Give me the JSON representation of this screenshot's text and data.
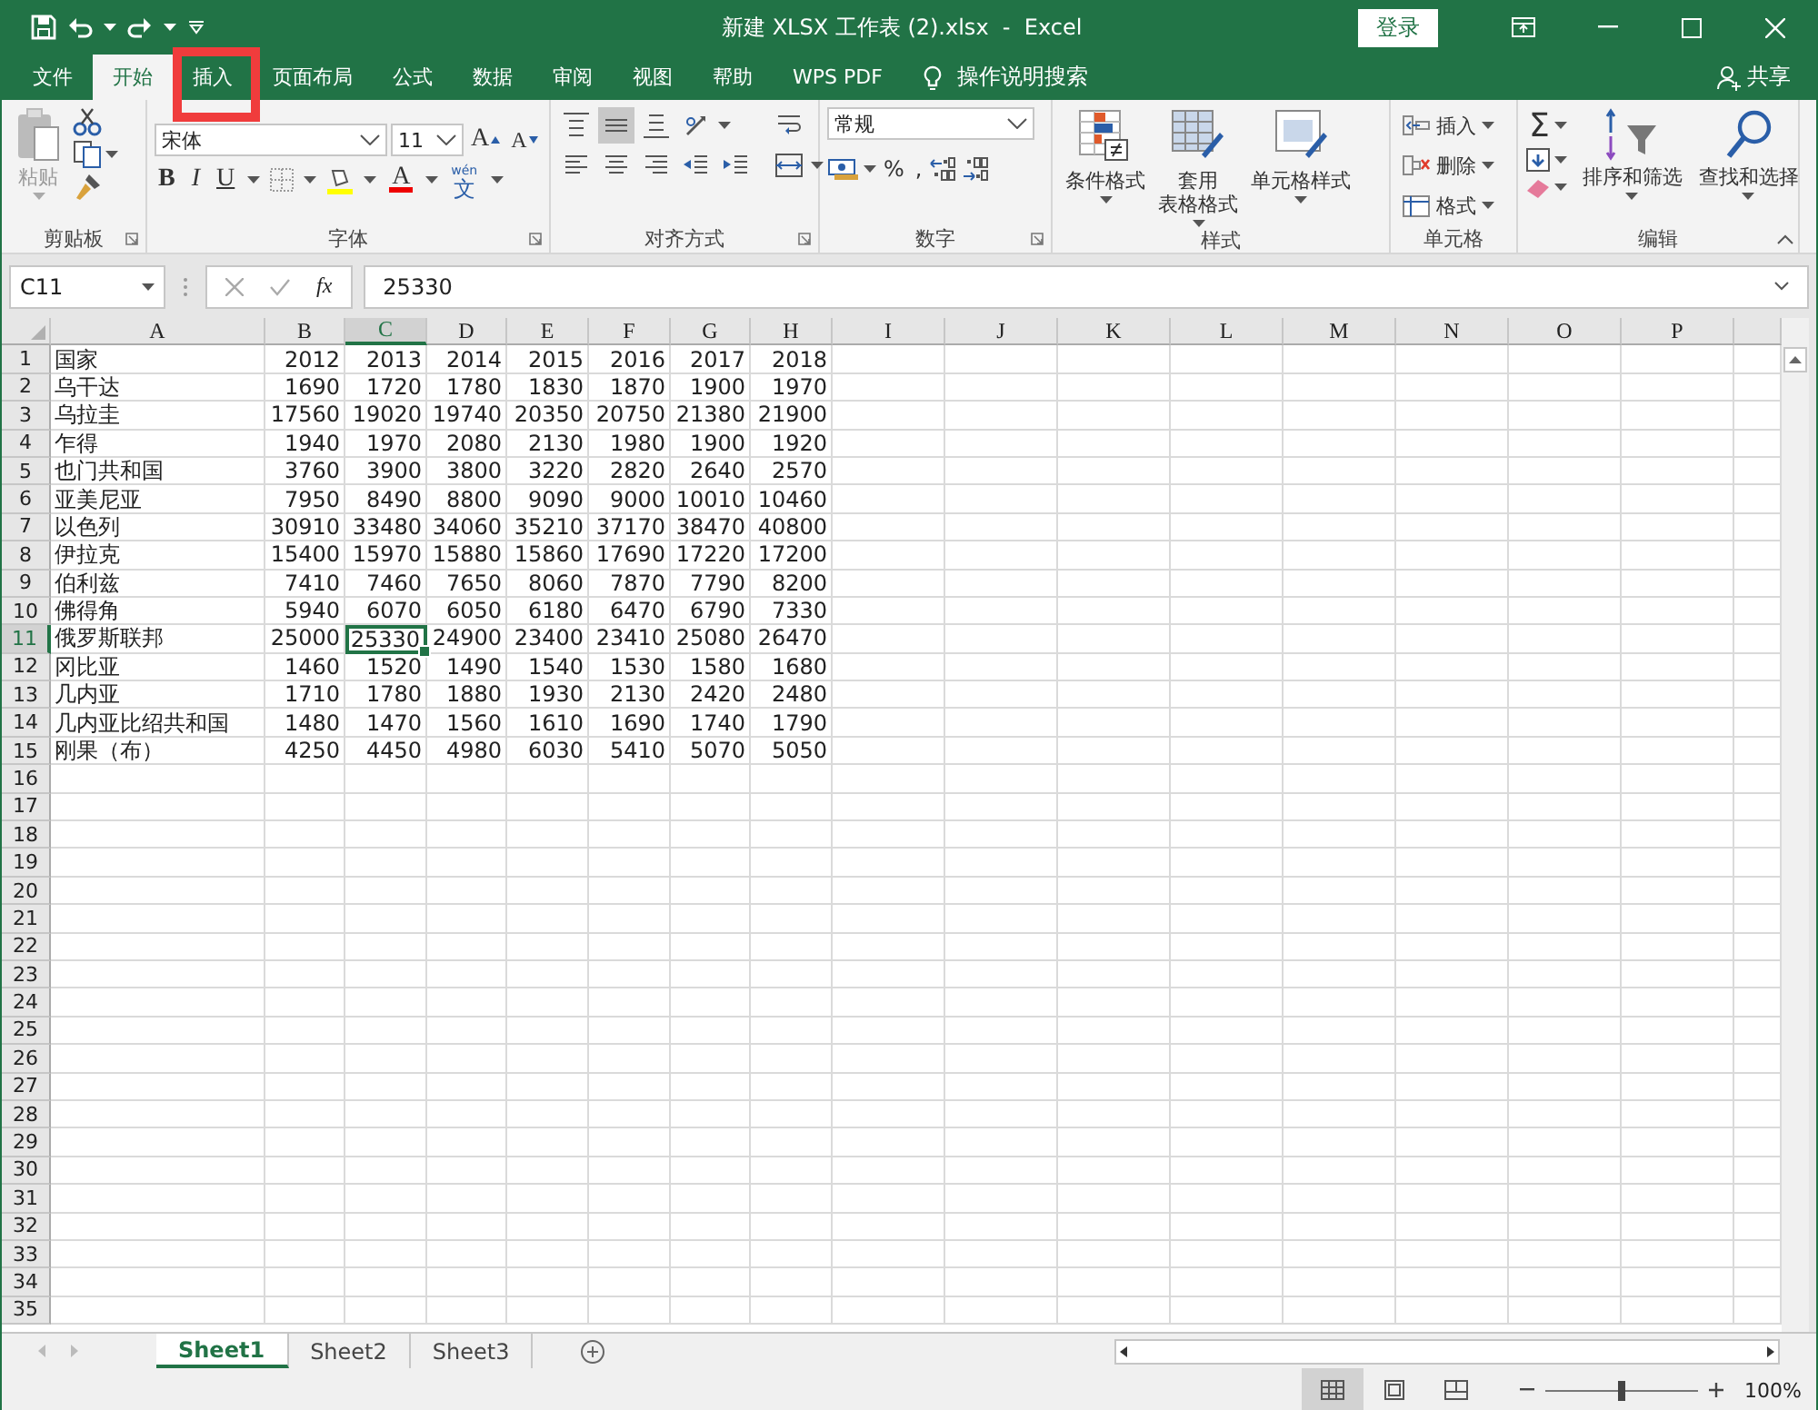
{
  "window": {
    "title": "新建 XLSX 工作表 (2).xlsx  -  Excel",
    "sign_in": "登录"
  },
  "tabs": [
    {
      "label": "文件",
      "selected": false
    },
    {
      "label": "开始",
      "selected": true
    },
    {
      "label": "插入",
      "selected": false
    },
    {
      "label": "页面布局",
      "selected": false
    },
    {
      "label": "公式",
      "selected": false
    },
    {
      "label": "数据",
      "selected": false
    },
    {
      "label": "审阅",
      "selected": false
    },
    {
      "label": "视图",
      "selected": false
    },
    {
      "label": "帮助",
      "selected": false
    },
    {
      "label": "WPS PDF",
      "selected": false
    }
  ],
  "tell_me": "操作说明搜索",
  "share": "共享",
  "ribbon": {
    "clipboard": {
      "label": "剪贴板",
      "paste": {
        "label": "粘贴",
        "disabled": true
      }
    },
    "font": {
      "label": "字体",
      "font_name": "宋体",
      "font_size": "11",
      "grow": "A",
      "shrink": "A",
      "bold": "B",
      "italic": "I",
      "underline": "U",
      "font_color": "A",
      "phonetic": {
        "ruby": "wén",
        "label": "文"
      }
    },
    "alignment": {
      "label": "对齐方式",
      "top_row": [
        {
          "kind": "align-top",
          "selected": false
        },
        {
          "kind": "align-middle",
          "selected": true
        },
        {
          "kind": "align-bottom",
          "selected": false
        },
        {
          "kind": "orientation",
          "selected": false
        }
      ],
      "bottom_row": [
        {
          "kind": "align-left",
          "selected": false
        },
        {
          "kind": "align-center",
          "selected": false
        },
        {
          "kind": "align-right",
          "selected": false
        },
        {
          "kind": "outdent",
          "selected": false
        },
        {
          "kind": "indent",
          "selected": false
        }
      ],
      "side": [
        {
          "kind": "wrap",
          "selected": false
        },
        {
          "kind": "merge",
          "selected": false
        }
      ]
    },
    "number": {
      "label": "数字",
      "format": "常规",
      "percent": "%",
      "comma": ","
    },
    "styles": {
      "label": "样式",
      "buttons": [
        {
          "kind": "conditional",
          "lines": [
            "条件格式"
          ]
        },
        {
          "kind": "table",
          "lines": [
            "套用",
            "表格格式"
          ]
        },
        {
          "kind": "cell-style",
          "lines": [
            "单元格样式"
          ]
        }
      ]
    },
    "cells": {
      "label": "单元格",
      "buttons": [
        {
          "kind": "insert",
          "label": "插入"
        },
        {
          "kind": "delete",
          "label": "删除"
        },
        {
          "kind": "format",
          "label": "格式"
        }
      ]
    },
    "editing": {
      "label": "编辑",
      "autosum": "Σ",
      "sort": "排序和筛选",
      "find": "查找和选择"
    }
  },
  "formula_bar": {
    "name_box": "C11",
    "function": "fx",
    "value": "25330"
  },
  "columns": [
    {
      "label": "A",
      "selected": false
    },
    {
      "label": "B",
      "selected": false
    },
    {
      "label": "C",
      "selected": true
    },
    {
      "label": "D",
      "selected": false
    },
    {
      "label": "E",
      "selected": false
    },
    {
      "label": "F",
      "selected": false
    },
    {
      "label": "G",
      "selected": false
    },
    {
      "label": "H",
      "selected": false
    },
    {
      "label": "I",
      "selected": false
    },
    {
      "label": "J",
      "selected": false
    },
    {
      "label": "K",
      "selected": false
    },
    {
      "label": "L",
      "selected": false
    },
    {
      "label": "M",
      "selected": false
    },
    {
      "label": "N",
      "selected": false
    },
    {
      "label": "O",
      "selected": false
    },
    {
      "label": "P",
      "selected": false
    }
  ],
  "rows": [
    {
      "number": "1",
      "selected": false,
      "cells": [
        "国家",
        "2012",
        "2013",
        "2014",
        "2015",
        "2016",
        "2017",
        "2018"
      ]
    },
    {
      "number": "2",
      "selected": false,
      "cells": [
        "乌干达",
        "1690",
        "1720",
        "1780",
        "1830",
        "1870",
        "1900",
        "1970"
      ]
    },
    {
      "number": "3",
      "selected": false,
      "cells": [
        "乌拉圭",
        "17560",
        "19020",
        "19740",
        "20350",
        "20750",
        "21380",
        "21900"
      ]
    },
    {
      "number": "4",
      "selected": false,
      "cells": [
        "乍得",
        "1940",
        "1970",
        "2080",
        "2130",
        "1980",
        "1900",
        "1920"
      ]
    },
    {
      "number": "5",
      "selected": false,
      "cells": [
        "也门共和国",
        "3760",
        "3900",
        "3800",
        "3220",
        "2820",
        "2640",
        "2570"
      ]
    },
    {
      "number": "6",
      "selected": false,
      "cells": [
        "亚美尼亚",
        "7950",
        "8490",
        "8800",
        "9090",
        "9000",
        "10010",
        "10460"
      ]
    },
    {
      "number": "7",
      "selected": false,
      "cells": [
        "以色列",
        "30910",
        "33480",
        "34060",
        "35210",
        "37170",
        "38470",
        "40800"
      ]
    },
    {
      "number": "8",
      "selected": false,
      "cells": [
        "伊拉克",
        "15400",
        "15970",
        "15880",
        "15860",
        "17690",
        "17220",
        "17200"
      ]
    },
    {
      "number": "9",
      "selected": false,
      "cells": [
        "伯利兹",
        "7410",
        "7460",
        "7650",
        "8060",
        "7870",
        "7790",
        "8200"
      ]
    },
    {
      "number": "10",
      "selected": false,
      "cells": [
        "佛得角",
        "5940",
        "6070",
        "6050",
        "6180",
        "6470",
        "6790",
        "7330"
      ]
    },
    {
      "number": "11",
      "selected": true,
      "cells": [
        "俄罗斯联邦",
        "25000",
        "25330",
        "24900",
        "23400",
        "23410",
        "25080",
        "26470"
      ]
    },
    {
      "number": "12",
      "selected": false,
      "cells": [
        "冈比亚",
        "1460",
        "1520",
        "1490",
        "1540",
        "1530",
        "1580",
        "1680"
      ]
    },
    {
      "number": "13",
      "selected": false,
      "cells": [
        "几内亚",
        "1710",
        "1780",
        "1880",
        "1930",
        "2130",
        "2420",
        "2480"
      ]
    },
    {
      "number": "14",
      "selected": false,
      "cells": [
        "几内亚比绍共和国",
        "1480",
        "1470",
        "1560",
        "1610",
        "1690",
        "1740",
        "1790"
      ]
    },
    {
      "number": "15",
      "selected": false,
      "cells": [
        "刚果（布）",
        "4250",
        "4450",
        "4980",
        "6030",
        "5410",
        "5070",
        "5050"
      ]
    },
    {
      "number": "16",
      "selected": false
    },
    {
      "number": "17",
      "selected": false
    },
    {
      "number": "18",
      "selected": false
    },
    {
      "number": "19",
      "selected": false
    },
    {
      "number": "20",
      "selected": false
    },
    {
      "number": "21",
      "selected": false
    },
    {
      "number": "22",
      "selected": false
    },
    {
      "number": "23",
      "selected": false
    },
    {
      "number": "24",
      "selected": false
    },
    {
      "number": "25",
      "selected": false
    },
    {
      "number": "26",
      "selected": false
    },
    {
      "number": "27",
      "selected": false
    },
    {
      "number": "28",
      "selected": false
    },
    {
      "number": "29",
      "selected": false
    },
    {
      "number": "30",
      "selected": false
    },
    {
      "number": "31",
      "selected": false
    },
    {
      "number": "32",
      "selected": false
    },
    {
      "number": "33",
      "selected": false
    },
    {
      "number": "34",
      "selected": false
    },
    {
      "number": "35",
      "selected": false
    }
  ],
  "sheets": [
    {
      "label": "Sheet1",
      "selected": true
    },
    {
      "label": "Sheet2",
      "selected": false
    },
    {
      "label": "Sheet3",
      "selected": false
    }
  ],
  "status_bar": {
    "views": [
      {
        "kind": "normal",
        "selected": true
      },
      {
        "kind": "page-layout",
        "selected": false
      },
      {
        "kind": "page-break",
        "selected": false
      }
    ],
    "zoom": {
      "level": 0.5,
      "reading": "100%"
    }
  },
  "annotations": [
    {
      "kind": "frame"
    }
  ]
}
